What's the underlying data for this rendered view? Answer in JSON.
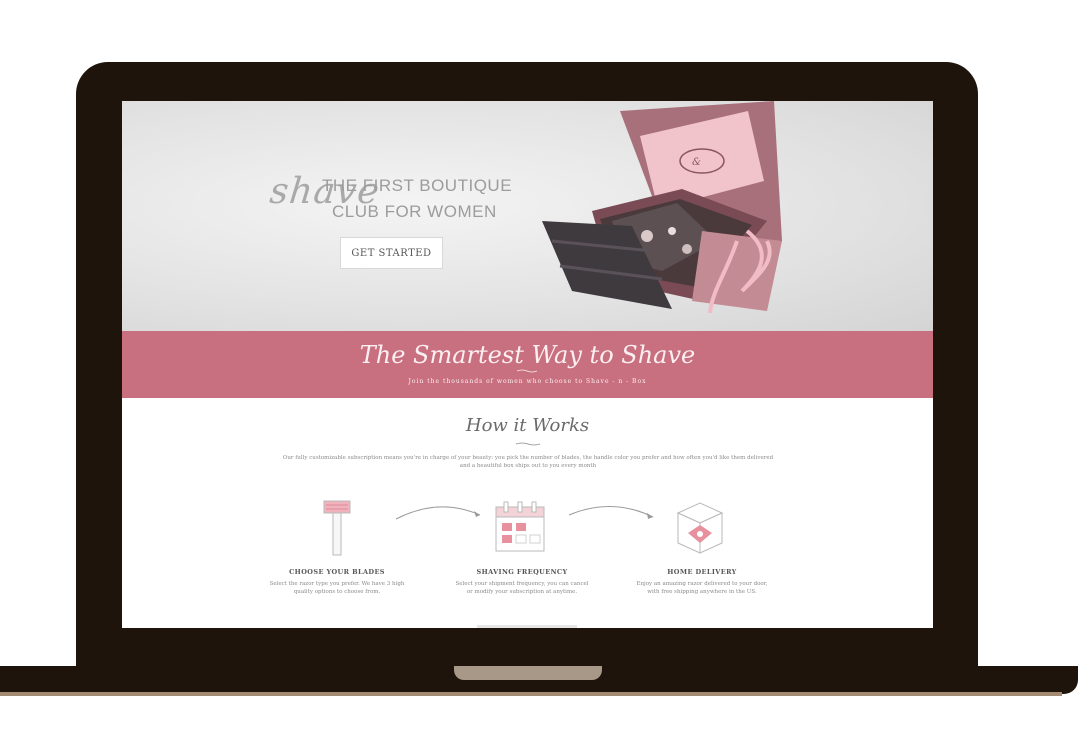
{
  "hero": {
    "script_word": "shave",
    "line1": "THE FIRST BOUTIQUE",
    "line2": "CLUB FOR WOMEN",
    "cta_label": "GET STARTED"
  },
  "banner": {
    "title": "The Smartest Way to Shave",
    "subtitle": "Join the thousands of women who choose to Shave - n - Box"
  },
  "how_it_works": {
    "title": "How it Works",
    "description": "Our fully customizable subscription means you're in charge of your beauty: you pick the number of blades, the handle color you prefer and how often you'd like them delivered and a beautiful box ships out to you every month",
    "steps": [
      {
        "title": "CHOOSE YOUR BLADES",
        "description": "Select the razor type you prefer. We have 3 high quality options to choose from.",
        "icon": "razor-icon"
      },
      {
        "title": "SHAVING FREQUENCY",
        "description": "Select your shipment frequency, you can cancel or modify your subscription at anytime.",
        "icon": "calendar-icon"
      },
      {
        "title": "HOME DELIVERY",
        "description": "Enjoy an amazing razor delivered to your door, with free shipping anywhere in the US.",
        "icon": "box-icon"
      }
    ]
  },
  "colors": {
    "accent_pink": "#c8707f",
    "laptop_frame": "#1e140c"
  }
}
